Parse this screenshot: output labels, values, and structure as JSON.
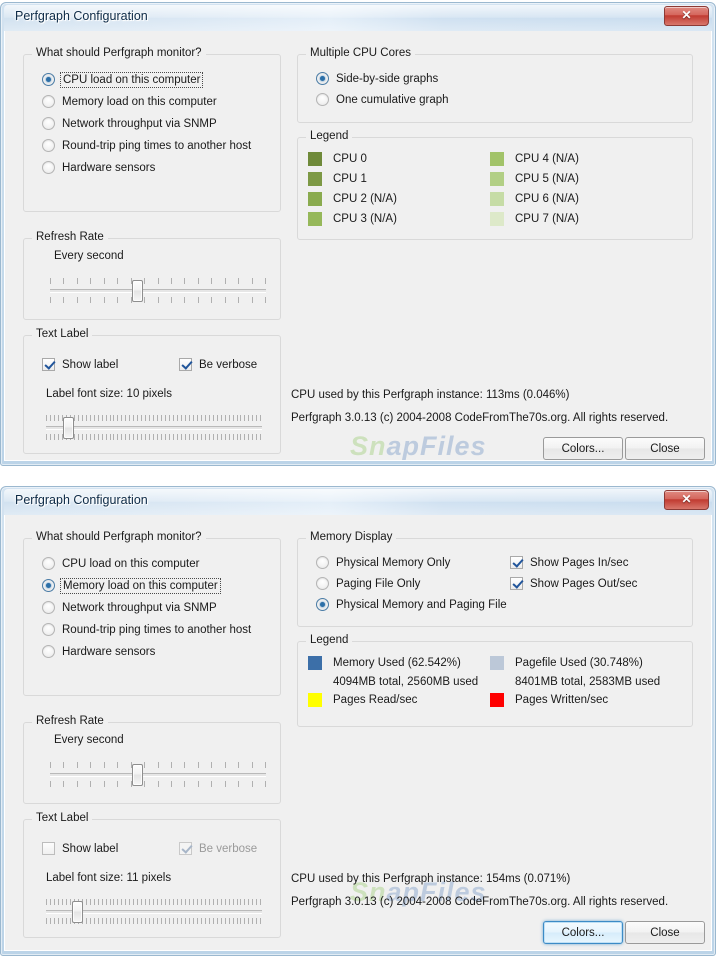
{
  "windows": [
    {
      "title": "Perfgraph Configuration",
      "close_label": "✕",
      "monitor_group": {
        "legend": "What should Perfgraph monitor?",
        "options": [
          {
            "label": "CPU load on this computer",
            "checked": true,
            "focused": true
          },
          {
            "label": "Memory load on this computer",
            "checked": false,
            "focused": false
          },
          {
            "label": "Network throughput via SNMP",
            "checked": false,
            "focused": false
          },
          {
            "label": "Round-trip ping times to another host",
            "checked": false,
            "focused": false
          },
          {
            "label": "Hardware sensors",
            "checked": false,
            "focused": false
          }
        ]
      },
      "refresh_group": {
        "legend": "Refresh Rate",
        "value_label": "Every second",
        "thumb_percent": 39,
        "tick_count": 17
      },
      "textlabel_group": {
        "legend": "Text Label",
        "show_label": {
          "label": "Show label",
          "checked": true,
          "enabled": true
        },
        "be_verbose": {
          "label": "Be verbose",
          "checked": true,
          "enabled": true
        },
        "font_size_label": "Label font size: 10 pixels",
        "thumb_percent": 8,
        "tick_count": 55
      },
      "right_group_1": {
        "legend": "Multiple CPU Cores",
        "options": [
          {
            "label": "Side-by-side graphs",
            "checked": true
          },
          {
            "label": "One cumulative graph",
            "checked": false
          }
        ]
      },
      "legend_group": {
        "legend": "Legend",
        "left_items": [
          {
            "label": "CPU 0",
            "color": "#6f8a3a"
          },
          {
            "label": "CPU 1",
            "color": "#7d9945"
          },
          {
            "label": "CPU 2 (N/A)",
            "color": "#8aab4f"
          },
          {
            "label": "CPU 3 (N/A)",
            "color": "#96b85a"
          }
        ],
        "right_items": [
          {
            "label": "CPU 4 (N/A)",
            "color": "#a2c369"
          },
          {
            "label": "CPU 5 (N/A)",
            "color": "#b2cf85"
          },
          {
            "label": "CPU 6 (N/A)",
            "color": "#c6dca6"
          },
          {
            "label": "CPU 7 (N/A)",
            "color": "#dde9c9"
          }
        ]
      },
      "status": {
        "cpu_used": "CPU used by this Perfgraph instance: 113ms (0.046%)",
        "copyright": "Perfgraph 3.0.13 (c) 2004-2008 CodeFromThe70s.org. All rights reserved."
      },
      "buttons": {
        "colors": {
          "label": "Colors...",
          "focused": false
        },
        "close": {
          "label": "Close",
          "focused": false
        }
      }
    },
    {
      "title": "Perfgraph Configuration",
      "close_label": "✕",
      "monitor_group": {
        "legend": "What should Perfgraph monitor?",
        "options": [
          {
            "label": "CPU load on this computer",
            "checked": false,
            "focused": false
          },
          {
            "label": "Memory load on this computer",
            "checked": true,
            "focused": true
          },
          {
            "label": "Network throughput via SNMP",
            "checked": false,
            "focused": false
          },
          {
            "label": "Round-trip ping times to another host",
            "checked": false,
            "focused": false
          },
          {
            "label": "Hardware sensors",
            "checked": false,
            "focused": false
          }
        ]
      },
      "refresh_group": {
        "legend": "Refresh Rate",
        "value_label": "Every second",
        "thumb_percent": 39,
        "tick_count": 17
      },
      "textlabel_group": {
        "legend": "Text Label",
        "show_label": {
          "label": "Show label",
          "checked": false,
          "enabled": true
        },
        "be_verbose": {
          "label": "Be verbose",
          "checked": true,
          "enabled": false
        },
        "font_size_label": "Label font size: 11 pixels",
        "thumb_percent": 12,
        "tick_count": 55
      },
      "right_group_1": {
        "legend": "Memory Display",
        "options": [
          {
            "label": "Physical Memory Only",
            "checked": false
          },
          {
            "label": "Paging File Only",
            "checked": false
          },
          {
            "label": "Physical Memory and Paging File",
            "checked": true
          }
        ],
        "checkboxes": [
          {
            "label": "Show Pages In/sec",
            "checked": true
          },
          {
            "label": "Show Pages Out/sec",
            "checked": true
          }
        ]
      },
      "legend_group": {
        "legend": "Legend",
        "left_items": [
          {
            "label": "Memory Used (62.542%)",
            "sub": "4094MB total, 2560MB used",
            "color": "#3c6fa8"
          },
          {
            "label": "Pages Read/sec",
            "sub": "",
            "color": "#ffff00"
          }
        ],
        "right_items": [
          {
            "label": "Pagefile Used (30.748%)",
            "sub": "8401MB total, 2583MB used",
            "color": "#bcc8d8"
          },
          {
            "label": "Pages Written/sec",
            "sub": "",
            "color": "#fe0000"
          }
        ]
      },
      "status": {
        "cpu_used": "CPU used by this Perfgraph instance: 154ms (0.071%)",
        "copyright": "Perfgraph 3.0.13 (c) 2004-2008 CodeFromThe70s.org. All rights reserved."
      },
      "buttons": {
        "colors": {
          "label": "Colors...",
          "focused": true
        },
        "close": {
          "label": "Close",
          "focused": false
        }
      }
    }
  ],
  "watermark": {
    "part1": "Sn",
    "part2": "apFiles"
  }
}
